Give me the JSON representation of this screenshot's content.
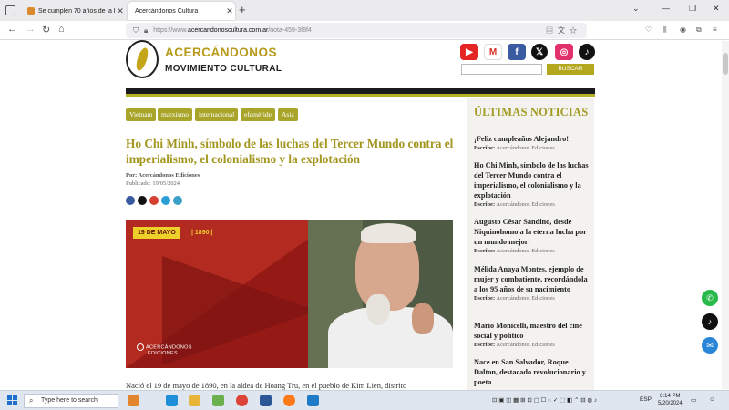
{
  "browser": {
    "tabs": [
      {
        "title": "Se cumplen 70 años de la bata",
        "active": false
      },
      {
        "title": "Acercándonos Cultura",
        "active": true
      }
    ],
    "url_prefix": "https://www.",
    "url_domain": "acercandonoscultura.com.ar",
    "url_path": "/nota-459-3f8f4"
  },
  "site": {
    "brand_line1": "ACERCÁNDONOS",
    "brand_line2": "MOVIMIENTO CULTURAL",
    "social_icons": [
      "youtube-icon",
      "gmail-icon",
      "facebook-icon",
      "x-icon",
      "instagram-icon",
      "tiktok-icon"
    ],
    "search_button": "BUSCAR",
    "accent_color": "#b3a71e"
  },
  "article": {
    "tags": [
      "Vietnam",
      "marxismo",
      "internacional",
      "efeméride",
      "Asia"
    ],
    "title": "Ho Chi Minh, símbolo de las luchas del Tercer Mundo contra el imperialismo, el colonialismo y la explotación",
    "byline": "Por: Acercándonos Ediciones",
    "published": "Publicado: 19/05/2024",
    "hero_date": "19 DE MAYO",
    "hero_year": "| 1890 |",
    "hero_logo_line1": "ACERCÁNDONOS",
    "hero_logo_line2": "EDICIONES",
    "body_start": "Nació el 19 de mayo de 1890, en la aldea de Hoang Tru, en el pueblo de Kim Lien, distrito"
  },
  "sidebar": {
    "title": "ÚLTIMAS NOTICIAS",
    "items": [
      {
        "headline": "¡Feliz cumpleaños Alejandro!",
        "label": "Escribe:",
        "author": "Acercándonos Ediciones"
      },
      {
        "headline": "Ho Chi Minh, símbolo de las luchas del Tercer Mundo contra el imperialismo, el colonialismo y la explotación",
        "label": "Escribe:",
        "author": "Acercándonos Ediciones"
      },
      {
        "headline": "Augusto César Sandino, desde Niquinohomo a la eterna lucha por un mundo mejor",
        "label": "Escribe:",
        "author": "Acercándonos Ediciones"
      },
      {
        "headline": "Mélida Anaya Montes, ejemplo de mujer y combatiente, recordándola a los 95 años de su nacimiento",
        "label": "Escribe:",
        "author": "Acercándonos Ediciones"
      },
      {
        "headline": "Mario Monicelli, maestro del cine social y político",
        "label": "Escribe:",
        "author": "Acercándonos Ediciones"
      },
      {
        "headline": "Nace en San Salvador, Roque Dalton, destacado revolucionario y poeta",
        "label": "",
        "author": ""
      }
    ]
  },
  "taskbar": {
    "search_placeholder": "Type here to search",
    "language": "ESP",
    "time": "8:14 PM",
    "date": "5/20/2024"
  }
}
